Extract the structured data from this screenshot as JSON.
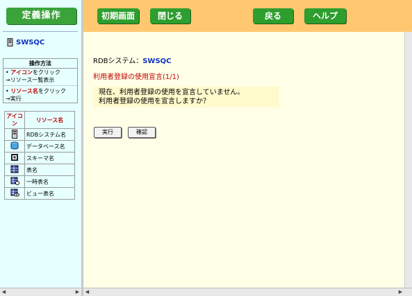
{
  "sidebar": {
    "title": "定義操作",
    "system_name": "SWSQC",
    "howto": {
      "heading": "操作方法",
      "line1_red": "アイコン",
      "line1_rest": "をクリック",
      "line2": "→リソース一覧表示",
      "line3_red": "リソース名",
      "line3_rest": "をクリック",
      "line4": "→実行"
    },
    "legend": {
      "col_icon": "アイコン",
      "col_name": "リソース名",
      "rows": [
        {
          "icon": "rdb-system-icon",
          "label": "RDBシステム名"
        },
        {
          "icon": "database-icon",
          "label": "データベース名"
        },
        {
          "icon": "schema-icon",
          "label": "スキーマ名"
        },
        {
          "icon": "table-icon",
          "label": "表名"
        },
        {
          "icon": "temp-table-icon",
          "label": "一時表名"
        },
        {
          "icon": "view-icon",
          "label": "ビュー表名"
        }
      ]
    }
  },
  "toolbar": {
    "initial_screen": "初期画面",
    "close": "閉じる",
    "back": "戻る",
    "help": "ヘルプ"
  },
  "main": {
    "rdb_label": "RDBシステム：",
    "rdb_name": "SWSQC",
    "heading": "利用者登録の使用宣言(1/1)",
    "message_line1": "現在、利用者登録の使用を宣言していません。",
    "message_line2": "利用者登録の使用を宣言しますか？",
    "execute": "実行",
    "confirm": "確認"
  },
  "colors": {
    "toolbar_bg": "#ffc870",
    "button_green": "#2e9e2e",
    "sidebar_bg": "#e6ffff",
    "main_bg": "#ffffe8"
  }
}
